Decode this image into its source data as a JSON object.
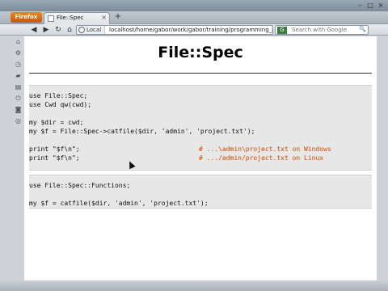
{
  "window": {
    "title": "",
    "controls": [
      "–",
      "□",
      "×"
    ]
  },
  "browser_menu": {
    "label": "Firefox"
  },
  "tabs": [
    {
      "label": "File::Spec",
      "close": "×"
    }
  ],
  "new_tab_glyph": "+",
  "nav": {
    "back": "◀",
    "forward": "▶",
    "reload": "↻",
    "home": "⌂",
    "identity_label": "Local",
    "url": "localhost/home/gabor/work/gabor/training/programming_per",
    "search_engine": "G",
    "search_placeholder": "Search with Google",
    "search_go": "🔍"
  },
  "left_toolbar_icons": [
    "tag-icon",
    "gear-icon",
    "clock-icon",
    "bookmark-icon",
    "page-icon",
    "power-icon",
    "camera-icon",
    "globe-icon"
  ],
  "slide": {
    "title": "File::Spec",
    "code_block_1": [
      {
        "code": "use File::Spec;",
        "comment": ""
      },
      {
        "code": "use Cwd qw(cwd);",
        "comment": ""
      },
      {
        "code": "",
        "comment": ""
      },
      {
        "code": "my $dir = cwd;",
        "comment": ""
      },
      {
        "code": "my $f = File::Spec->catfile($dir, 'admin', 'project.txt');",
        "comment": ""
      },
      {
        "code": "",
        "comment": ""
      },
      {
        "code": "print \"$f\\n\";",
        "comment": "# ...\\admin\\project.txt on Windows"
      },
      {
        "code": "print \"$f\\n\";",
        "comment": "# .../admin/project.txt on Linux"
      }
    ],
    "code_block_2": [
      {
        "code": "use File::Spec::Functions;",
        "comment": ""
      },
      {
        "code": "",
        "comment": ""
      },
      {
        "code": "my $f = catfile($dir, 'admin', 'project.txt');",
        "comment": ""
      }
    ]
  },
  "status_text": ""
}
